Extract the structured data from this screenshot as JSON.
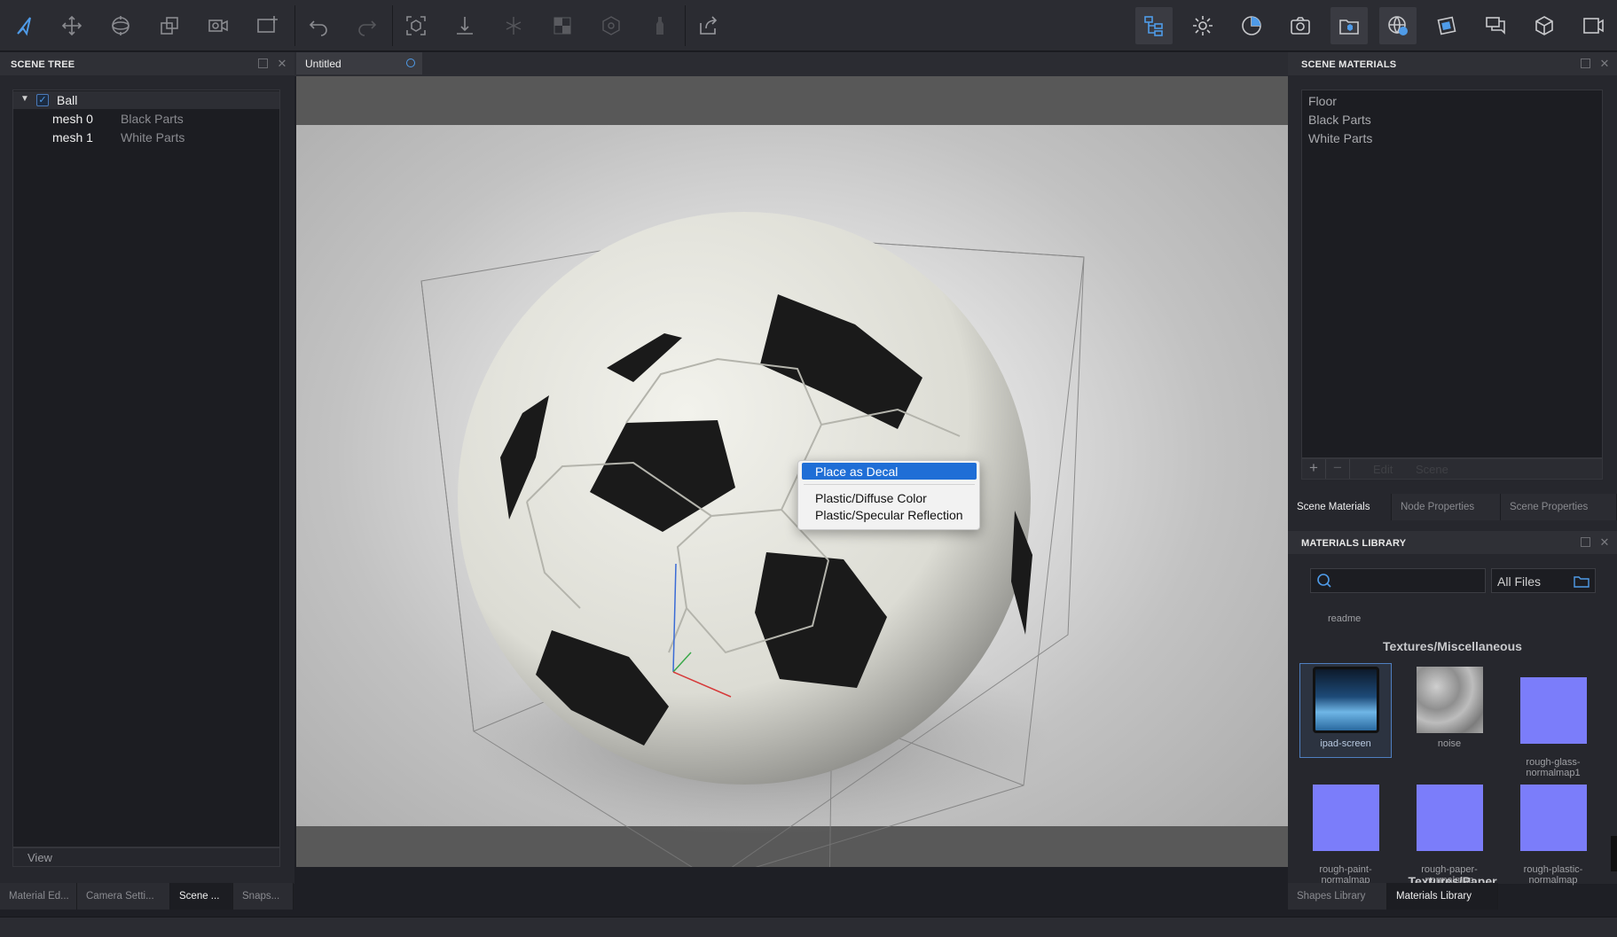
{
  "scene_tree": {
    "title": "SCENE TREE",
    "root": "Ball",
    "rows": [
      {
        "name": "mesh 0",
        "material": "Black Parts"
      },
      {
        "name": "mesh 1",
        "material": "White Parts"
      }
    ],
    "view_label": "View",
    "tabs": [
      "Material Ed...",
      "Camera Setti...",
      "Scene ...",
      "Snaps..."
    ]
  },
  "document": {
    "tab_title": "Untitled"
  },
  "context_menu": {
    "items": [
      "Place as Decal",
      "Plastic/Diffuse Color",
      "Plastic/Specular Reflection"
    ]
  },
  "scene_materials": {
    "title": "SCENE MATERIALS",
    "items": [
      "Floor",
      "Black Parts",
      "White Parts"
    ],
    "footer": {
      "add": "+",
      "remove": "−",
      "edit": "Edit",
      "scene": "Scene"
    },
    "tabs": [
      "Scene Materials",
      "Node Properties",
      "Scene Properties"
    ]
  },
  "materials_library": {
    "title": "MATERIALS LIBRARY",
    "filter_value": "All Files",
    "readme_label": "readme",
    "section_title": "Textures/Miscellaneous",
    "next_section": "Textures/Paper",
    "thumbnails": [
      {
        "label": "ipad-screen"
      },
      {
        "label": "noise"
      },
      {
        "label": "rough-glass-\nnormalmap1"
      },
      {
        "label": "rough-paint-\nnormalmap"
      },
      {
        "label": "rough-paper-\nnormalmap"
      },
      {
        "label": "rough-plastic-\nnormalmap"
      }
    ],
    "tabs": [
      "Shapes Library",
      "Materials Library"
    ]
  },
  "colors": {
    "accent": "#1f6ed6",
    "normalmap": "#7b7dfa",
    "panel_bg": "#26272d"
  }
}
